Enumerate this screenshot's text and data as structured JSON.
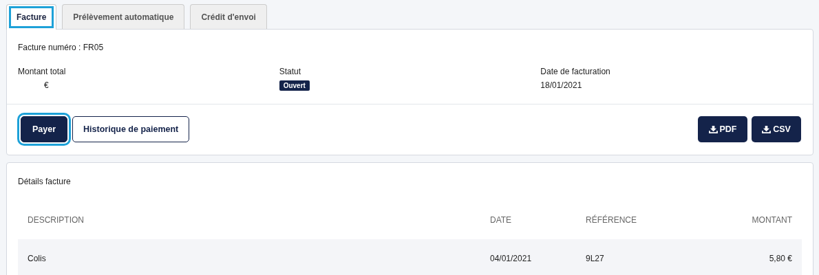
{
  "tabs": [
    {
      "label": "Facture",
      "selected": true,
      "highlighted": true
    },
    {
      "label": "Prélèvement automatique",
      "selected": false,
      "highlighted": false
    },
    {
      "label": "Crédit d'envoi",
      "selected": false,
      "highlighted": false
    }
  ],
  "invoice": {
    "number_line": "Facture numéro : FR05",
    "fields": [
      {
        "kind": "text",
        "label": "Montant total",
        "value": "€"
      },
      {
        "kind": "badge",
        "label": "Statut",
        "value": "Ouvert"
      },
      {
        "kind": "text",
        "label": "Date de facturation",
        "value": "18/01/2021"
      }
    ],
    "actions": [
      {
        "label": "Payer",
        "kind": "primary",
        "highlighted": true
      },
      {
        "label": "Historique de paiement",
        "kind": "outline",
        "highlighted": false
      }
    ],
    "downloads": [
      "PDF",
      "CSV"
    ]
  },
  "details": {
    "title": "Détails facture",
    "columns": [
      "DESCRIPTION",
      "DATE",
      "RÉFÉRENCE",
      "MONTANT"
    ],
    "rows": [
      [
        "Colis",
        "04/01/2021",
        "9L27",
        "5,80 €"
      ]
    ]
  }
}
